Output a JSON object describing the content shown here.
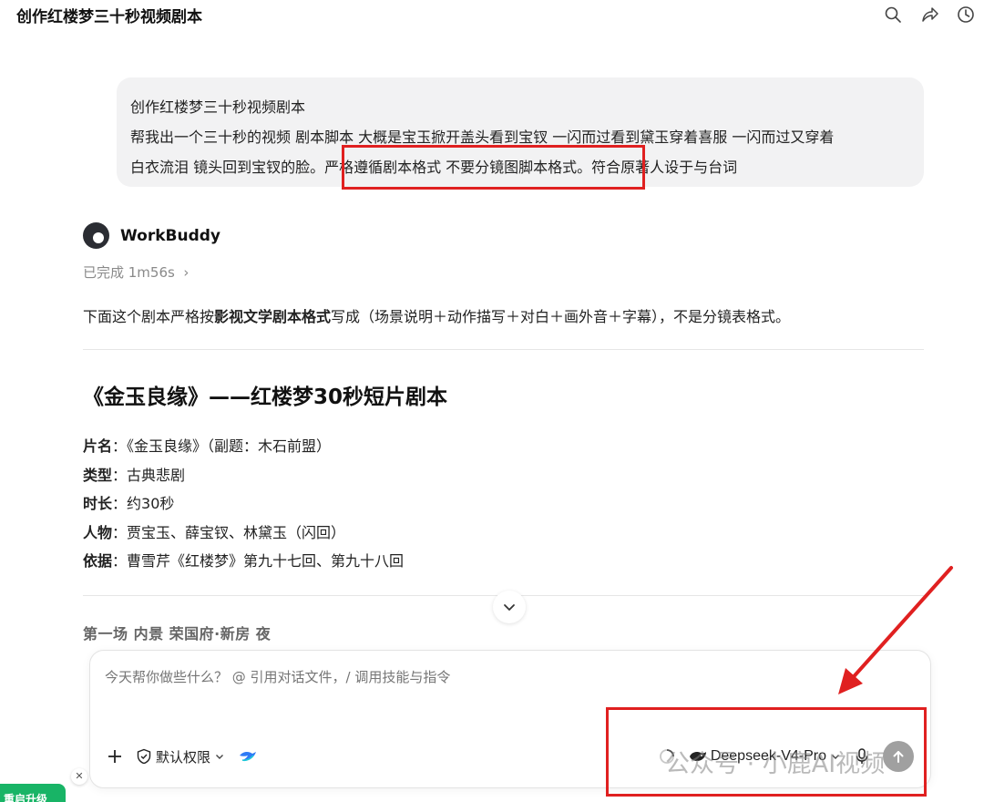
{
  "header": {
    "title": "创作红楼梦三十秒视频剧本",
    "icons": [
      "search-icon",
      "share-icon",
      "history-icon"
    ]
  },
  "user_message": {
    "line1": "创作红楼梦三十秒视频剧本",
    "line2": "帮我出一个三十秒的视频 剧本脚本 大概是宝玉掀开盖头看到宝钗 一闪而过看到黛玉穿着喜服 一闪而过又穿着",
    "line3": "白衣流泪 镜头回到宝钗的脸。严格遵循剧本格式  不要分镜图脚本格式。符合原著人设于与台词"
  },
  "assistant": {
    "name": "WorkBuddy",
    "status": "已完成 1m56s",
    "intro_pre": "下面这个剧本严格按",
    "intro_bold": "影视文学剧本格式",
    "intro_post": "写成（场景说明＋动作描写＋对白＋画外音＋字幕），不是分镜表格式。"
  },
  "script": {
    "title": "《金玉良缘》——红楼梦30秒短片剧本",
    "meta": [
      {
        "key": "片名",
        "sep": "：",
        "value": "《金玉良缘》（副题：木石前盟）"
      },
      {
        "key": "类型",
        "sep": "：",
        "value": "古典悲剧"
      },
      {
        "key": "时长",
        "sep": "：",
        "value": "约30秒"
      },
      {
        "key": "人物",
        "sep": "：",
        "value": "贾宝玉、薛宝钗、林黛玉（闪回）"
      },
      {
        "key": "依据",
        "sep": "：",
        "value": "曹雪芹《红楼梦》第九十七回、第九十八回"
      }
    ],
    "scene_heading": "第一场   内景   荣国府·新房   夜"
  },
  "composer": {
    "placeholder": "今天帮你做些什么？ @ 引用对话文件，/ 调用技能与指令",
    "permission_label": "默认权限",
    "model_label": "Deepseek-V4-Pro"
  },
  "watermark": "公众号 · 小鹿AI视频",
  "upgrade_label": "重启升级",
  "colors": {
    "highlight_red": "#e02020",
    "upgrade_green": "#18b466"
  }
}
